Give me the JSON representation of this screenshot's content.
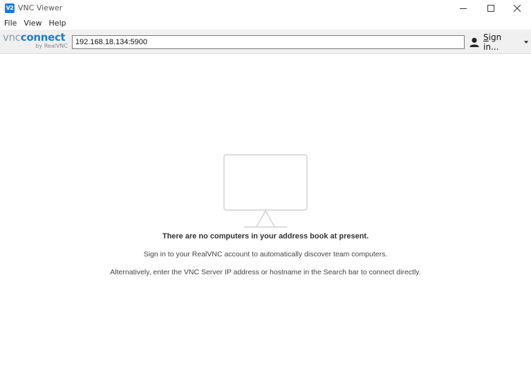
{
  "window": {
    "title": "VNC Viewer",
    "app_icon_text": "V2"
  },
  "menu": {
    "items": [
      "File",
      "View",
      "Help"
    ]
  },
  "toolbar": {
    "logo_vnc": "vnc",
    "logo_connect": "connect",
    "logo_sub": "by RealVNC",
    "address_value": "192.168.18.134:5900",
    "signin_label_first": "S",
    "signin_label_rest": "ign in..."
  },
  "empty_state": {
    "title": "There are no computers in your address book at present.",
    "line1": "Sign in to your RealVNC account to automatically discover team computers.",
    "line2": "Alternatively, enter the VNC Server IP address or hostname in the Search bar to connect directly."
  },
  "colors": {
    "accent": "#1a7ed6",
    "toolbar_bg": "#f0f0f0",
    "illustration_stroke": "#c8c8c8"
  },
  "icons": {
    "app": "vnc-app-icon",
    "minimize": "minimize-icon",
    "maximize": "maximize-icon",
    "close": "close-icon",
    "user": "user-icon",
    "dropdown": "chevron-down-icon",
    "illustration": "monitor-icon"
  }
}
